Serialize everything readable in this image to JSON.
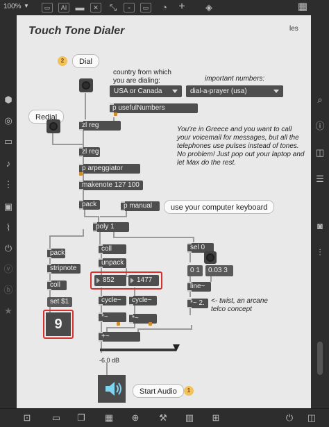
{
  "toolbar": {
    "zoom": "100%",
    "top_icons": [
      "presentation-icon",
      "ai-icon",
      "comment-icon",
      "close-box-icon",
      "patchcord-icon",
      "gauge-icon",
      "plus-icon",
      "paint-bucket-icon",
      "grid-icon"
    ],
    "ai_label": "AI"
  },
  "left_sidebar_icons": [
    "package-icon",
    "record-icon",
    "toggle-icon",
    "music-note-icon",
    "dotted-bar-icon",
    "image-icon",
    "paperclip-icon",
    "plug-icon",
    "v-circle-icon",
    "b-circle-icon",
    "star-icon"
  ],
  "right_sidebar_icons": [
    "search-icon",
    "info-icon",
    "columns-icon",
    "list-icon",
    "camera-icon",
    "sliders-icon"
  ],
  "bottom_icons": [
    "lock-icon",
    "presentation-icon",
    "windows-icon",
    "grid-icon",
    "plus-icon",
    "wrench-icon",
    "piano-icon",
    "table-icon",
    "power-icon",
    "columns-icon"
  ],
  "patch": {
    "title": "Touch Tone Dialer",
    "author": "les",
    "dial_bubble": "Dial",
    "dial_badge": "2",
    "redial_bubble": "Redial",
    "country_label": "country from which\nyou are dialing:",
    "important_label": "important numbers:",
    "country_menu": "USA or Canada",
    "numbers_menu": "dial-a-prayer (usa)",
    "objects": {
      "p_usefulNumbers": "p usefulNumbers",
      "zl_reg_1": "zl reg",
      "zl_reg_2": "zl reg",
      "p_arpeggiator": "p arpeggiator",
      "makenote": "makenote 127 100",
      "pack": "pack",
      "p_manual": "p manual",
      "poly": "poly 1",
      "pack2": "pack",
      "stripnote": "stripnote",
      "coll_left": "coll",
      "coll_mid": "coll",
      "unpack": "unpack",
      "sel": "sel 0",
      "cycle1": "cycle~",
      "cycle2": "cycle~",
      "mul1": "*~",
      "mul2": "*~",
      "plus": "+~",
      "line": "line~",
      "mul3": "*~ 2."
    },
    "manual_bubble": "use your computer keyboard",
    "greece_comment": "You're in Greece and you want to call your voicemail for messages, but all the telephones use pulses instead of tones. No problem! Just pop out your laptop and let Max do the rest.",
    "numbers": {
      "freq1": "852",
      "freq2": "1477"
    },
    "msg_set": "set $1",
    "big_digit": "9",
    "msg_01": "0 1",
    "msg_003": "0.03 3",
    "twist_comment": "<- twist, an arcane\ntelco concept",
    "gain_label": "-6.0 dB",
    "start_audio": "Start Audio",
    "start_badge": "1",
    "accent_red": "#d9302b",
    "badge_color": "#f2c25a"
  }
}
